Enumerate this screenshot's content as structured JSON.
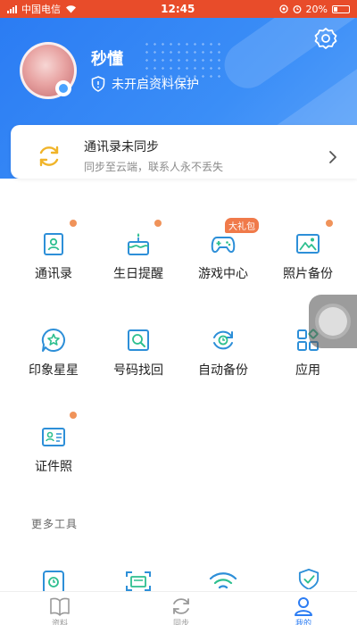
{
  "status_bar": {
    "carrier": "中国电信",
    "time": "12:45",
    "battery": "20%"
  },
  "profile": {
    "username": "秒懂",
    "protection_status": "未开启资料保护"
  },
  "sync_card": {
    "title": "通讯录未同步",
    "subtitle": "同步至云端，联系人永不丢失"
  },
  "features": [
    {
      "label": "通讯录",
      "icon": "contacts-icon",
      "has_dot": true
    },
    {
      "label": "生日提醒",
      "icon": "birthday-cake-icon",
      "has_dot": true
    },
    {
      "label": "游戏中心",
      "icon": "gamepad-icon",
      "badge": "大礼包"
    },
    {
      "label": "照片备份",
      "icon": "photo-icon",
      "has_dot": true
    },
    {
      "label": "印象星星",
      "icon": "star-chat-icon"
    },
    {
      "label": "号码找回",
      "icon": "number-recovery-icon"
    },
    {
      "label": "自动备份",
      "icon": "auto-backup-icon"
    },
    {
      "label": "应用",
      "icon": "apps-grid-icon"
    },
    {
      "label": "证件照",
      "icon": "id-card-icon",
      "has_dot": true
    }
  ],
  "more_tools": {
    "title": "更多工具",
    "tools": [
      {
        "icon": "clock-tool-icon"
      },
      {
        "icon": "scan-tool-icon"
      },
      {
        "icon": "wifi-tool-icon"
      },
      {
        "icon": "shield-check-tool-icon"
      }
    ]
  },
  "tab_bar": {
    "tabs": [
      {
        "label": "资料",
        "icon": "book-icon"
      },
      {
        "label": "同步",
        "icon": "sync-icon"
      },
      {
        "label": "我的",
        "icon": "person-icon",
        "active": true
      }
    ]
  },
  "colors": {
    "header_blue": "#2b7cf3",
    "status_bar": "#e84c2a",
    "accent_orange": "#f0935a",
    "icon_blue": "#2d8fd8",
    "icon_green": "#2dbf8f"
  }
}
